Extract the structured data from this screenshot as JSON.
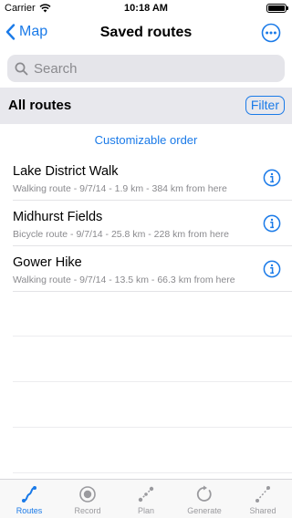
{
  "status_bar": {
    "carrier": "Carrier",
    "time": "10:18 AM",
    "battery_level": 1.0
  },
  "nav": {
    "back_label": "Map",
    "title": "Saved routes"
  },
  "search": {
    "placeholder": "Search",
    "value": ""
  },
  "section": {
    "title": "All routes",
    "filter_label": "Filter"
  },
  "order_link": "Customizable order",
  "routes": [
    {
      "name": "Lake District Walk",
      "detail": "Walking route - 9/7/14 - 1.9 km - 384 km from here"
    },
    {
      "name": "Midhurst Fields",
      "detail": "Bicycle route - 9/7/14 - 25.8 km - 228 km from here"
    },
    {
      "name": "Gower Hike",
      "detail": "Walking route - 9/7/14 - 13.5 km - 66.3 km from here"
    }
  ],
  "tabs": [
    {
      "label": "Routes",
      "active": true
    },
    {
      "label": "Record",
      "active": false
    },
    {
      "label": "Plan",
      "active": false
    },
    {
      "label": "Generate",
      "active": false
    },
    {
      "label": "Shared",
      "active": false
    }
  ],
  "colors": {
    "accent": "#1a7ae8",
    "inactive": "#9a9a9e",
    "header_bg": "#e8e8ed"
  }
}
